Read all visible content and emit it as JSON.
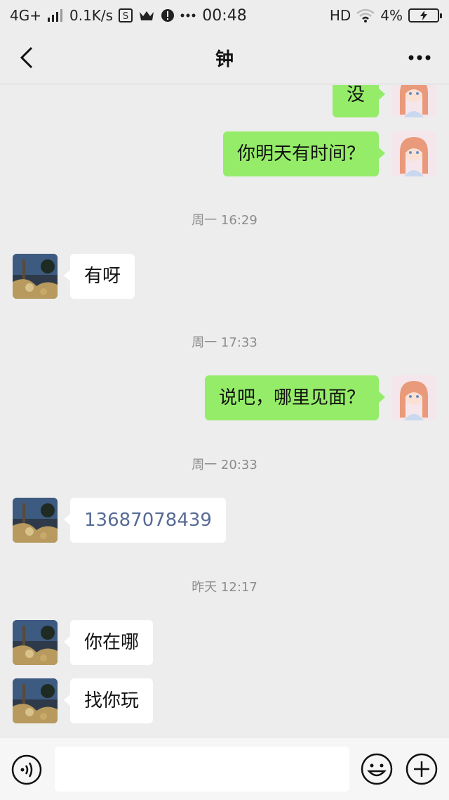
{
  "status_bar": {
    "network": "4G+",
    "speed": "0.1K/s",
    "time": "00:48",
    "hd": "HD",
    "battery_percent": "4%",
    "icons": [
      "signal-icon",
      "s-icon",
      "crown-icon",
      "alert-icon",
      "more-dots-icon",
      "wifi-icon",
      "battery-charging-icon"
    ]
  },
  "nav": {
    "title": "钟",
    "back_icon": "chevron-left-icon",
    "more_icon": "more-dots-icon"
  },
  "chat": {
    "messages": [
      {
        "side": "me",
        "text": "没"
      },
      {
        "side": "me",
        "text": "你明天有时间？"
      },
      {
        "type": "time",
        "text": "周一 16:29"
      },
      {
        "side": "them",
        "text": "有呀"
      },
      {
        "type": "time",
        "text": "周一 17:33"
      },
      {
        "side": "me",
        "text": "说吧，哪里见面？"
      },
      {
        "type": "time",
        "text": "周一 20:33"
      },
      {
        "side": "them",
        "text": "13687078439",
        "style": "link"
      },
      {
        "type": "time",
        "text": "昨天 12:17"
      },
      {
        "side": "them",
        "text": "你在哪"
      },
      {
        "side": "them",
        "text": "找你玩"
      }
    ]
  },
  "input_bar": {
    "value": "",
    "voice_icon": "voice-icon",
    "emoji_icon": "emoji-icon",
    "plus_icon": "plus-icon"
  },
  "colors": {
    "background": "#ededed",
    "my_bubble": "#95ec69",
    "their_bubble": "#ffffff",
    "link_text": "#576b95"
  }
}
